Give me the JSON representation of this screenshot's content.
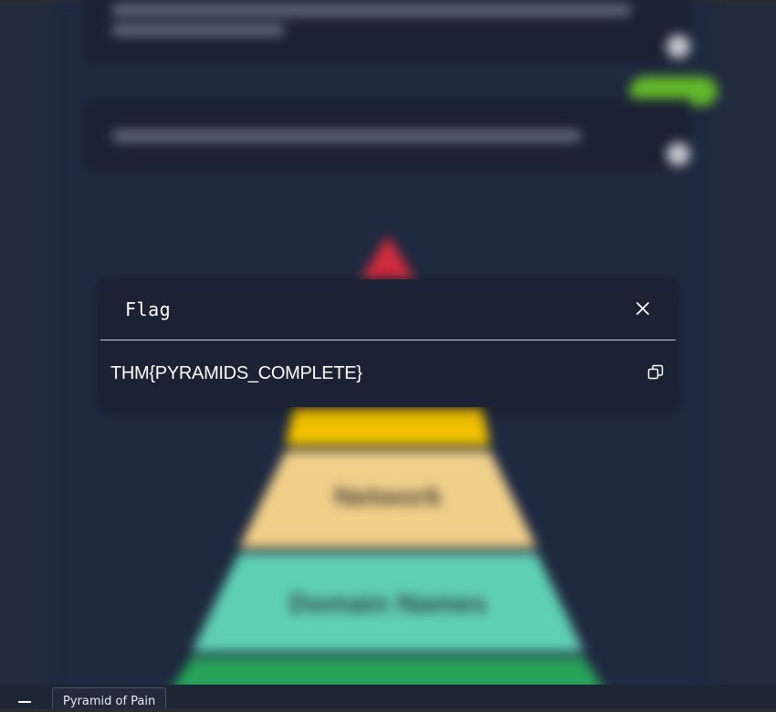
{
  "modal": {
    "title": "Flag",
    "value": "THM{PYRAMIDS_COMPLETE}",
    "close_icon": "close-icon",
    "copy_icon": "copy-icon"
  },
  "background": {
    "pyramid_tiers": [
      {
        "label": "Network",
        "color": "#f1d08a"
      },
      {
        "label": "Domain Names",
        "color": "#5fd0b4"
      }
    ],
    "colors": {
      "top": "#d02c3c",
      "yellow": "#f2c200",
      "bottom": "#27a35a",
      "accent": "#62b92a"
    }
  },
  "taskbar": {
    "minimize_icon": "minimize-icon",
    "tab_label": "Pyramid of Pain"
  }
}
